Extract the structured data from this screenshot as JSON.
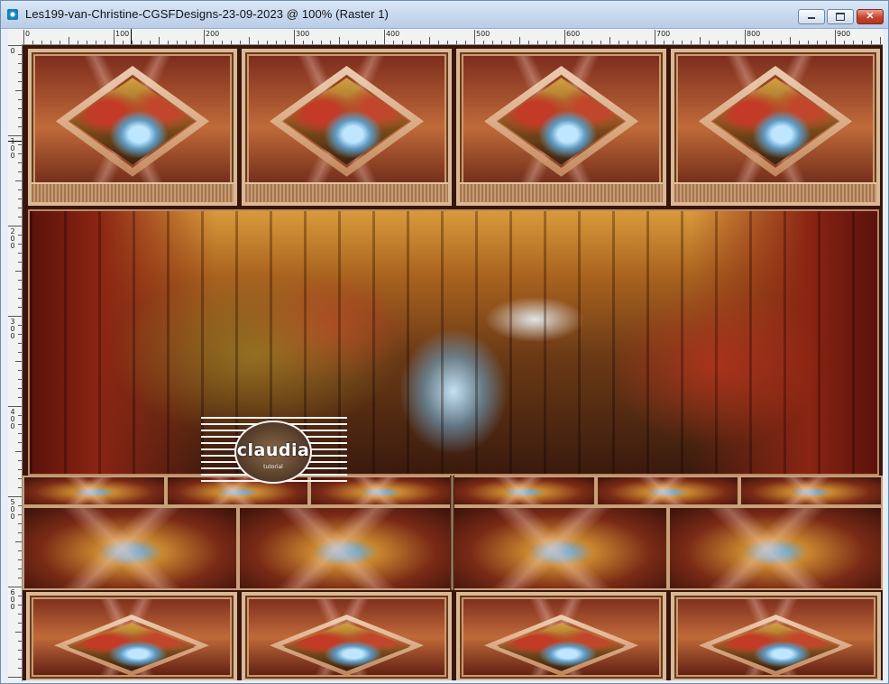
{
  "window": {
    "title": "Les199-van-Christine-CGSFDesigns-23-09-2023 @ 100% (Raster 1)",
    "minimize_label": "",
    "maximize_label": "",
    "close_label": "✕",
    "accent_color": "#c7432b"
  },
  "ruler_horizontal": {
    "labels": [
      "0",
      "100",
      "200",
      "300",
      "400",
      "500",
      "600",
      "700",
      "800",
      "900"
    ]
  },
  "ruler_vertical": {
    "labels": [
      "0",
      "100",
      "200",
      "300",
      "400",
      "500",
      "600"
    ]
  },
  "canvas": {
    "layer_name": "Raster 1",
    "zoom": "100%",
    "top_panels_count": 4,
    "bottom_panels_count": 4,
    "watermark": {
      "text": "claudia",
      "subtext": "tutorial"
    }
  }
}
